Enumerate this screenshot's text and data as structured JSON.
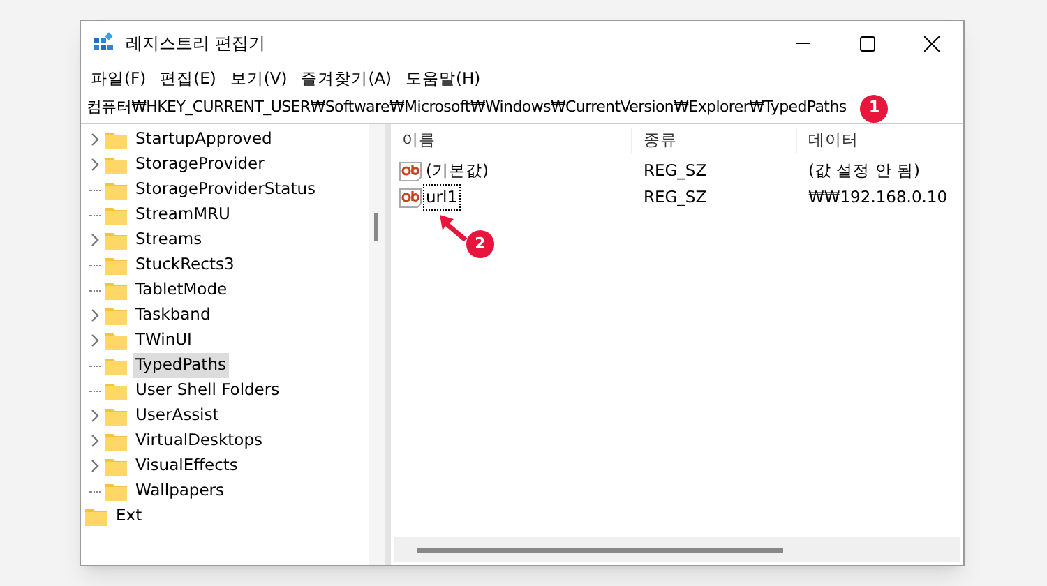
{
  "window": {
    "title": "레지스트리 편집기"
  },
  "menu": [
    "파일(F)",
    "편집(E)",
    "보기(V)",
    "즐겨찾기(A)",
    "도움말(H)"
  ],
  "address": "컴퓨터₩HKEY_CURRENT_USER₩Software₩Microsoft₩Windows₩CurrentVersion₩Explorer₩TypedPaths",
  "tree": {
    "children": [
      {
        "label": "StartupApproved",
        "expandable": true,
        "selected": false
      },
      {
        "label": "StorageProvider",
        "expandable": true,
        "selected": false
      },
      {
        "label": "StorageProviderStatus",
        "expandable": false,
        "selected": false
      },
      {
        "label": "StreamMRU",
        "expandable": false,
        "selected": false
      },
      {
        "label": "Streams",
        "expandable": true,
        "selected": false
      },
      {
        "label": "StuckRects3",
        "expandable": false,
        "selected": false
      },
      {
        "label": "TabletMode",
        "expandable": false,
        "selected": false
      },
      {
        "label": "Taskband",
        "expandable": true,
        "selected": false
      },
      {
        "label": "TWinUI",
        "expandable": true,
        "selected": false
      },
      {
        "label": "TypedPaths",
        "expandable": false,
        "selected": true
      },
      {
        "label": "User Shell Folders",
        "expandable": false,
        "selected": false
      },
      {
        "label": "UserAssist",
        "expandable": true,
        "selected": false
      },
      {
        "label": "VirtualDesktops",
        "expandable": true,
        "selected": false
      },
      {
        "label": "VisualEffects",
        "expandable": true,
        "selected": false
      },
      {
        "label": "Wallpapers",
        "expandable": false,
        "selected": false
      }
    ],
    "after": [
      {
        "label": "Ext",
        "selected": false
      }
    ]
  },
  "table": {
    "columns": [
      "이름",
      "종류",
      "데이터"
    ],
    "rows": [
      {
        "cells": [
          "(기본값)",
          "REG_SZ",
          "(값 설정 안 됨)"
        ],
        "focused": false
      },
      {
        "cells": [
          "url1",
          "REG_SZ",
          "₩₩192.168.0.10"
        ],
        "focused": true
      }
    ]
  },
  "annotations": [
    "1",
    "2"
  ]
}
